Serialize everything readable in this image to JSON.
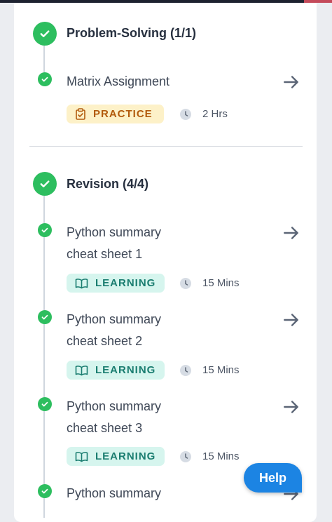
{
  "sections": [
    {
      "title": "Problem-Solving (1/1)",
      "items": [
        {
          "title": "Matrix Assignment",
          "badge": "PRACTICE",
          "badge_type": "practice",
          "duration": "2 Hrs"
        }
      ]
    },
    {
      "title": "Revision (4/4)",
      "items": [
        {
          "title_lines": [
            "Python summary",
            "cheat sheet 1"
          ],
          "badge": "LEARNING",
          "badge_type": "learning",
          "duration": "15 Mins"
        },
        {
          "title_lines": [
            "Python summary",
            "cheat sheet 2"
          ],
          "badge": "LEARNING",
          "badge_type": "learning",
          "duration": "15 Mins"
        },
        {
          "title_lines": [
            "Python summary",
            "cheat sheet 3"
          ],
          "badge": "LEARNING",
          "badge_type": "learning",
          "duration": "15 Mins"
        },
        {
          "title_lines": [
            "Python summary"
          ]
        }
      ]
    }
  ],
  "help": {
    "label": "Help"
  },
  "icons": {
    "status": "check-circle-icon",
    "navigate": "arrow-right-icon",
    "practice": "clipboard-icon",
    "learning": "book-open-icon",
    "duration": "clock-icon"
  },
  "colors": {
    "complete": "#2dbe5f",
    "practice_bg": "#fdf1c8",
    "practice_text": "#b25a0c",
    "learning_bg": "#d6f5ee",
    "learning_text": "#1a7d70",
    "help_button": "#1c84e3"
  }
}
